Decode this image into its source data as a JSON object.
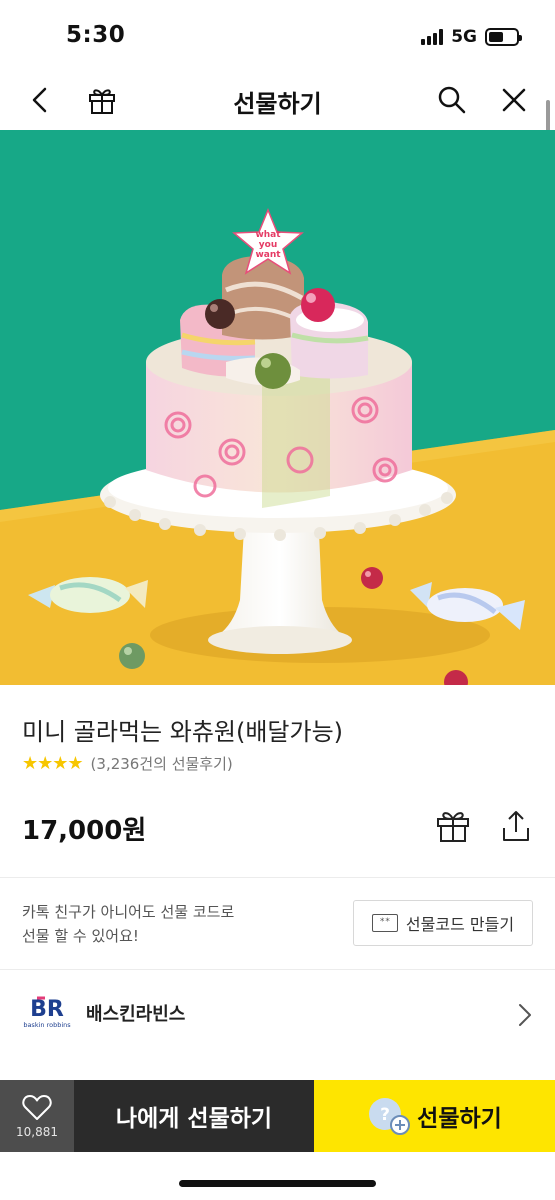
{
  "status_bar": {
    "time": "5:30",
    "network": "5G"
  },
  "nav": {
    "title": "선물하기"
  },
  "hero": {
    "topper_line1": "what",
    "topper_line2": "you",
    "topper_line3": "want"
  },
  "product": {
    "title": "미니 골라먹는 와츄원(배달가능)",
    "stars": "★★★★",
    "review_count": "(3,236건의 선물후기)",
    "price": "17,000원"
  },
  "gift_code": {
    "description_line1": "카톡 친구가 아니어도 선물 코드로",
    "description_line2": "선물 할 수 있어요!",
    "button_icon_text": "**",
    "button_label": "선물코드 만들기"
  },
  "brand": {
    "logo_text": "BR",
    "logo_subtext": "baskin robbins",
    "name": "배스킨라빈스"
  },
  "bottom_bar": {
    "like_count": "10,881",
    "self_gift_label": "나에게 선물하기",
    "gift_label": "선물하기"
  },
  "colors": {
    "kakao_yellow": "#fee500",
    "dark_button": "#2b2b2b",
    "star": "#f7c600",
    "hero_teal": "#17a887",
    "hero_yellow": "#f2bd32"
  }
}
